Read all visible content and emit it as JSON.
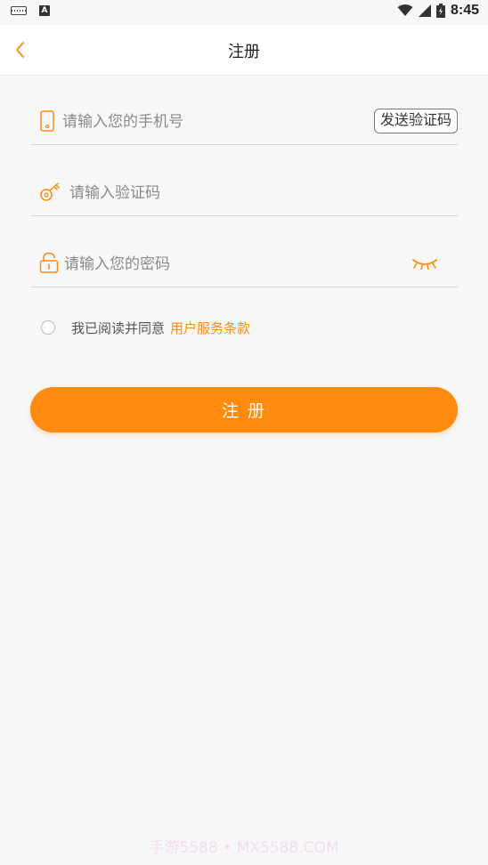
{
  "status_bar": {
    "time": "8:45",
    "icons": [
      "keyboard-icon",
      "a-app-icon",
      "wifi-icon",
      "signal-icon",
      "battery-icon"
    ]
  },
  "header": {
    "title": "注册",
    "back_icon": "chevron-left-icon"
  },
  "form": {
    "phone": {
      "placeholder": "请输入您的手机号",
      "value": "",
      "icon": "phone-icon"
    },
    "send_code_label": "发送验证码",
    "code": {
      "placeholder": "请输入验证码",
      "value": "",
      "icon": "key-icon"
    },
    "password": {
      "placeholder": "请输入您的密码",
      "value": "",
      "icon": "lock-icon",
      "toggle_icon": "eye-closed-icon"
    },
    "agreement": {
      "text": "我已阅读并同意",
      "link": "用户服务条款",
      "checked": false
    },
    "submit_label": "注  册"
  },
  "watermark": "手游5588 • MX5588.COM",
  "colors": {
    "accent": "#ff8a10",
    "background": "#f7f7f7",
    "divider": "#d4d4d4"
  }
}
